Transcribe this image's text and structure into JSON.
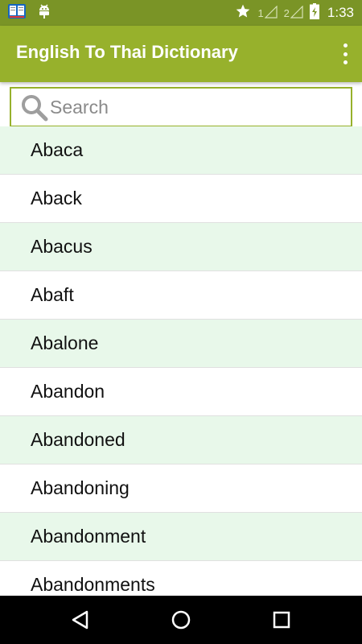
{
  "status_bar": {
    "icons": [
      "dictionary-app-icon",
      "android-debug-icon",
      "star-icon",
      "signal-1-icon",
      "signal-2-icon",
      "battery-charging-icon"
    ],
    "sim1_label": "1",
    "sim2_label": "2",
    "time": "1:33"
  },
  "app_bar": {
    "title": "English To Thai Dictionary",
    "menu_icon": "overflow-menu-icon"
  },
  "search": {
    "placeholder": "Search",
    "value": "",
    "icon": "search-icon"
  },
  "words": [
    "Abaca",
    "Aback",
    "Abacus",
    "Abaft",
    "Abalone",
    "Abandon",
    "Abandoned",
    "Abandoning",
    "Abandonment",
    "Abandonments"
  ],
  "colors": {
    "status_bar": "#7a9426",
    "app_bar": "#97b12c",
    "row_alt": "#e8f8ea",
    "row_plain": "#ffffff",
    "nav_bar": "#000000"
  },
  "nav_bar": {
    "icons": [
      "back-icon",
      "home-icon",
      "recents-icon"
    ]
  }
}
